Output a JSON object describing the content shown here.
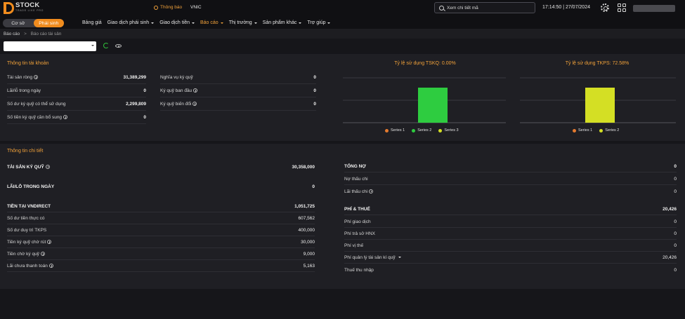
{
  "header": {
    "logo_text": "STOCK",
    "logo_sub": "TRADE LIKE PRO",
    "notification_label": "Thông báo",
    "ticker_label": "VNIC",
    "search_placeholder": "Xem chi tiết mã",
    "clock": "17:14:50 | 27/07/2024"
  },
  "nav": {
    "toggle": [
      "Cơ sở",
      "Phái sinh"
    ],
    "items": [
      {
        "label": "Bảng giá",
        "dropdown": false,
        "active": false
      },
      {
        "label": "Giao dịch phái sinh",
        "dropdown": true,
        "active": false
      },
      {
        "label": "Giao dịch tiền",
        "dropdown": true,
        "active": false
      },
      {
        "label": "Báo cáo",
        "dropdown": true,
        "active": true
      },
      {
        "label": "Thị trường",
        "dropdown": true,
        "active": false
      },
      {
        "label": "Sản phẩm khác",
        "dropdown": true,
        "active": false
      },
      {
        "label": "Trợ giúp",
        "dropdown": true,
        "active": false
      }
    ]
  },
  "breadcrumb": {
    "root": "Báo cáo",
    "separator": ">",
    "current": "Báo cáo tài sản"
  },
  "account": {
    "title": "Thông tin tài khoản",
    "left": [
      {
        "label": "Tài sản ròng",
        "value": "31,389,299",
        "info": true
      },
      {
        "label": "Lãi/lỗ trong ngày",
        "value": "0",
        "info": false
      },
      {
        "label": "Số dư ký quỹ có thể sử dụng",
        "value": "2,299,809",
        "info": false
      },
      {
        "label": "Số tiền ký quỹ cần bổ sung",
        "value": "0",
        "info": true
      }
    ],
    "right": [
      {
        "label": "Nghĩa vụ ký quỹ",
        "value": "0",
        "info": false
      },
      {
        "label": "Ký quỹ ban đầu",
        "value": "0",
        "info": true
      },
      {
        "label": "Ký quỹ biến đổi",
        "value": "0",
        "info": true
      }
    ]
  },
  "colors": {
    "accent": "#f08c1e",
    "series1": "#e57a2e",
    "series2": "#2ecc40",
    "series3": "#d4df24"
  },
  "chart_data": [
    {
      "type": "bar",
      "title": "Tỷ lệ sử dụng TSKQ: 0.00%",
      "categories": [
        ""
      ],
      "series": [
        {
          "name": "Series 1",
          "values": [
            0
          ],
          "color": "#e57a2e"
        },
        {
          "name": "Series 2",
          "values": [
            100
          ],
          "color": "#2ecc40"
        },
        {
          "name": "Series 3",
          "values": [
            0
          ],
          "color": "#d4df24"
        }
      ],
      "ylim": [
        0,
        100
      ],
      "legend": "bottom"
    },
    {
      "type": "bar",
      "title": "Tỷ lệ sử dụng TKPS: 72.58%",
      "categories": [
        ""
      ],
      "series": [
        {
          "name": "Series 1",
          "values": [
            0
          ],
          "color": "#e57a2e"
        },
        {
          "name": "Series 2",
          "values": [
            100
          ],
          "color": "#d4df24"
        }
      ],
      "ylim": [
        0,
        100
      ],
      "legend": "bottom"
    }
  ],
  "detail": {
    "title": "Thông tin chi tiết",
    "left": [
      {
        "label": "TÀI SẢN KÝ QUỸ",
        "value": "30,358,000",
        "head": true,
        "info": true
      },
      {
        "label": "LÃI/LỖ TRONG NGÀY",
        "value": "0",
        "head": true,
        "info": false
      },
      {
        "label": "TIỀN TẠI VNDIRECT",
        "value": "1,051,725",
        "head": true,
        "info": false
      },
      {
        "label": "Số dư tiền thực có",
        "value": "607,562",
        "head": false,
        "info": false
      },
      {
        "label": "Số dư duy trì TKPS",
        "value": "400,000",
        "head": false,
        "info": false
      },
      {
        "label": "Tiền ký quỹ chờ rút",
        "value": "30,000",
        "head": false,
        "info": true
      },
      {
        "label": "Tiền chờ ký quỹ",
        "value": "9,000",
        "head": false,
        "info": true
      },
      {
        "label": "Lãi chưa thanh toán",
        "value": "5,163",
        "head": false,
        "info": true
      }
    ],
    "right": [
      {
        "label": "TỔNG NỢ",
        "value": "0",
        "head": true,
        "info": false
      },
      {
        "label": "Nợ thấu chi",
        "value": "0",
        "head": false,
        "info": false
      },
      {
        "label": "Lãi thấu chi",
        "value": "0",
        "head": false,
        "info": true
      },
      {
        "label": "PHÍ & THUẾ",
        "value": "20,426",
        "head": true,
        "info": false
      },
      {
        "label": "Phí giao dịch",
        "value": "0",
        "head": false,
        "info": false
      },
      {
        "label": "Phí trả sở HNX",
        "value": "0",
        "head": false,
        "info": false
      },
      {
        "label": "Phí vị thế",
        "value": "0",
        "head": false,
        "info": false
      },
      {
        "label": "Phí quản lý tài sản kí quỹ",
        "value": "20,426",
        "head": false,
        "info": false,
        "caret": true
      },
      {
        "label": "Thuế thu nhập",
        "value": "0",
        "head": false,
        "info": false
      }
    ]
  }
}
